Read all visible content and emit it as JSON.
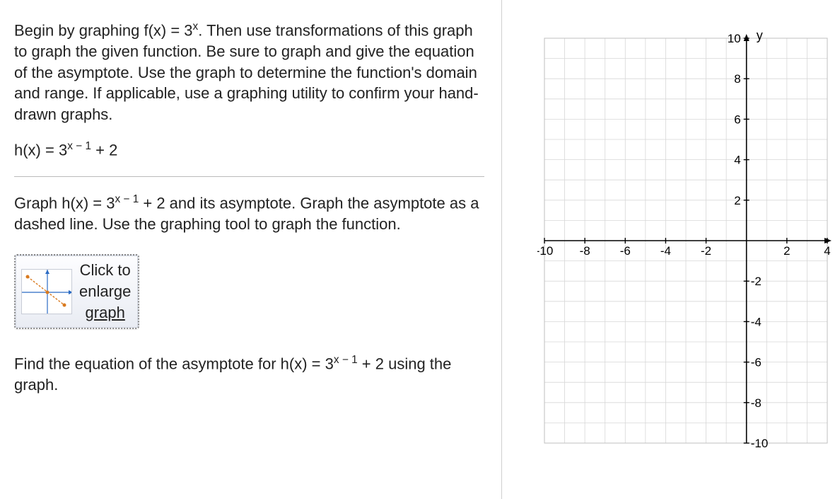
{
  "problem": {
    "intro1": "Begin by graphing f(x) = 3",
    "intro1_sup": "x",
    "intro1b": ". Then use transformations of this graph to graph the given function. Be sure to graph and give the equation of the asymptote. Use the graph to determine the function's domain and range. If applicable, use a graphing utility to confirm your hand-drawn graphs.",
    "fn_lhs": "h(x) = 3",
    "fn_sup": "x − 1",
    "fn_rhs": " + 2",
    "instr1": "Graph h(x) = 3",
    "instr1_sup": "x − 1",
    "instr1b": " + 2 and its asymptote. Graph the asymptote as a dashed line. Use the graphing tool to graph the function.",
    "button_line1": "Click to",
    "button_line2": "enlarge",
    "button_line3": "graph",
    "find1": "Find the equation of the asymptote for h(x) = 3",
    "find1_sup": "x − 1",
    "find1b": " + 2 using the graph."
  },
  "chart_data": {
    "type": "scatter",
    "title": "",
    "xlabel": "",
    "ylabel": "y",
    "xlim": [
      -10,
      4
    ],
    "ylim": [
      -10,
      10
    ],
    "xticks": [
      -10,
      -8,
      -6,
      -4,
      -2,
      2,
      4
    ],
    "yticks": [
      -10,
      -8,
      -6,
      -4,
      -2,
      2,
      4,
      6,
      8,
      10
    ],
    "ytick_labels_shown": [
      "10",
      "8",
      "6",
      "4",
      "2",
      "-2",
      "-4",
      "-6",
      "-8",
      "-10"
    ],
    "series": [],
    "grid": true,
    "y_axis_label": "y"
  }
}
